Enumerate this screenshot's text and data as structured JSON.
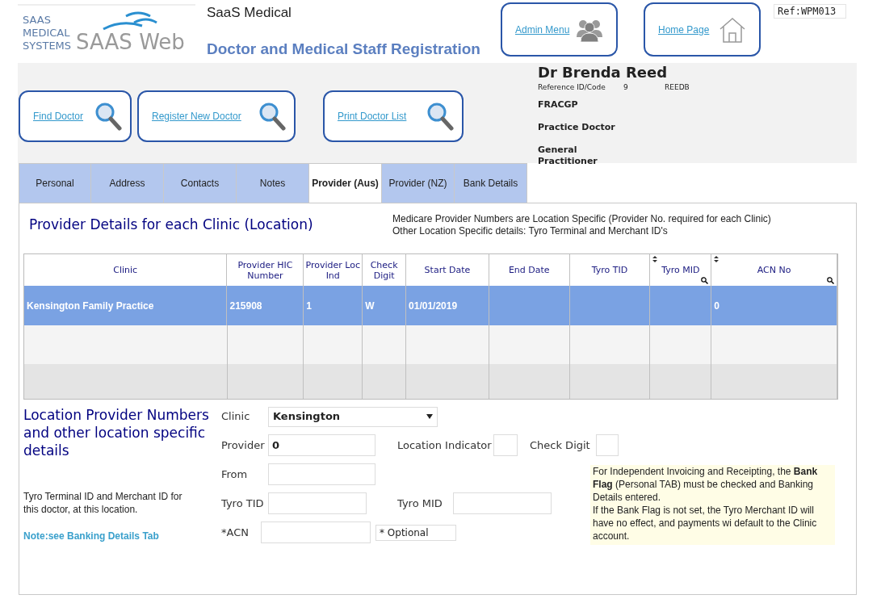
{
  "logo": {
    "lines": [
      "SAAS",
      "MEDICAL",
      "SYSTEMS"
    ],
    "wordmark": "SAAS Web"
  },
  "header": {
    "app_name": "SaaS Medical",
    "title": "Doctor and Medical Staff Registration",
    "ref": "Ref:WPM013"
  },
  "nav_buttons": [
    {
      "label": "Admin Menu",
      "kind": "people"
    },
    {
      "label": "Home Page",
      "kind": "home"
    }
  ],
  "action_buttons": [
    {
      "label": "Find Doctor"
    },
    {
      "label": "Register New Doctor"
    },
    {
      "label": "Print Doctor List"
    }
  ],
  "doctor": {
    "name": "Dr Brenda Reed",
    "ref_label": "Reference ID/Code",
    "ref_id": "9",
    "ref_code": "REEDB",
    "qualification": "FRACGP",
    "role": "Practice Doctor",
    "specialty": "General Practitioner"
  },
  "tabs": [
    {
      "label": "Personal",
      "selected": false
    },
    {
      "label": "Address",
      "selected": false
    },
    {
      "label": "Contacts",
      "selected": false
    },
    {
      "label": "Notes",
      "selected": false
    },
    {
      "label": "Provider (Aus)",
      "selected": true
    },
    {
      "label": "Provider (NZ)",
      "selected": false
    },
    {
      "label": "Bank Details",
      "selected": false
    }
  ],
  "provider_section": {
    "title": "Provider Details for each Clinic (Location)",
    "notes": [
      "Medicare Provider Numbers are Location Specific (Provider No. required for each Clinic)",
      "Other Location Specific details: Tyro Terminal and Merchant ID's"
    ]
  },
  "table": {
    "columns": [
      {
        "label": "Clinic",
        "filterable": false
      },
      {
        "label": "Provider HIC Number",
        "filterable": false
      },
      {
        "label": "Provider Loc Ind",
        "filterable": false
      },
      {
        "label": "Check Digit",
        "filterable": false
      },
      {
        "label": "Start Date",
        "filterable": false
      },
      {
        "label": "End Date",
        "filterable": false
      },
      {
        "label": "Tyro TID",
        "filterable": false
      },
      {
        "label": "Tyro MID",
        "filterable": true
      },
      {
        "label": "ACN No",
        "filterable": true
      }
    ],
    "rows": [
      {
        "selected": true,
        "cells": [
          "Kensington Family Practice",
          "215908",
          "1",
          "W",
          "01/01/2019",
          null,
          null,
          null,
          "0"
        ]
      }
    ]
  },
  "location_section": {
    "title": "Location Provider Numbers and other location specific details",
    "tyro_note": "Tyro Terminal ID and Merchant ID for this doctor, at this location.",
    "banking_link": "Note:see Banking Details Tab"
  },
  "form": {
    "clinic": {
      "label": "Clinic",
      "value": "Kensington"
    },
    "provider": {
      "label": "Provider",
      "value": "0"
    },
    "location_indicator": {
      "label": "Location Indicator"
    },
    "check_digit": {
      "label": "Check Digit"
    },
    "from": {
      "label": "From"
    },
    "tyro_tid": {
      "label": "Tyro TID"
    },
    "tyro_mid": {
      "label": "Tyro MID"
    },
    "acn": {
      "label": "*ACN"
    },
    "optional_note": "* Optional"
  },
  "bank_note": [
    "For Independent Invoicing and Receipting, the **Bank Flag** (Personal TAB) must be checked and Banking Details entered.",
    "If the Bank Flag is not set, the Tyro Merchant ID will have no effect, and payments wi default to the Clinic account."
  ]
}
